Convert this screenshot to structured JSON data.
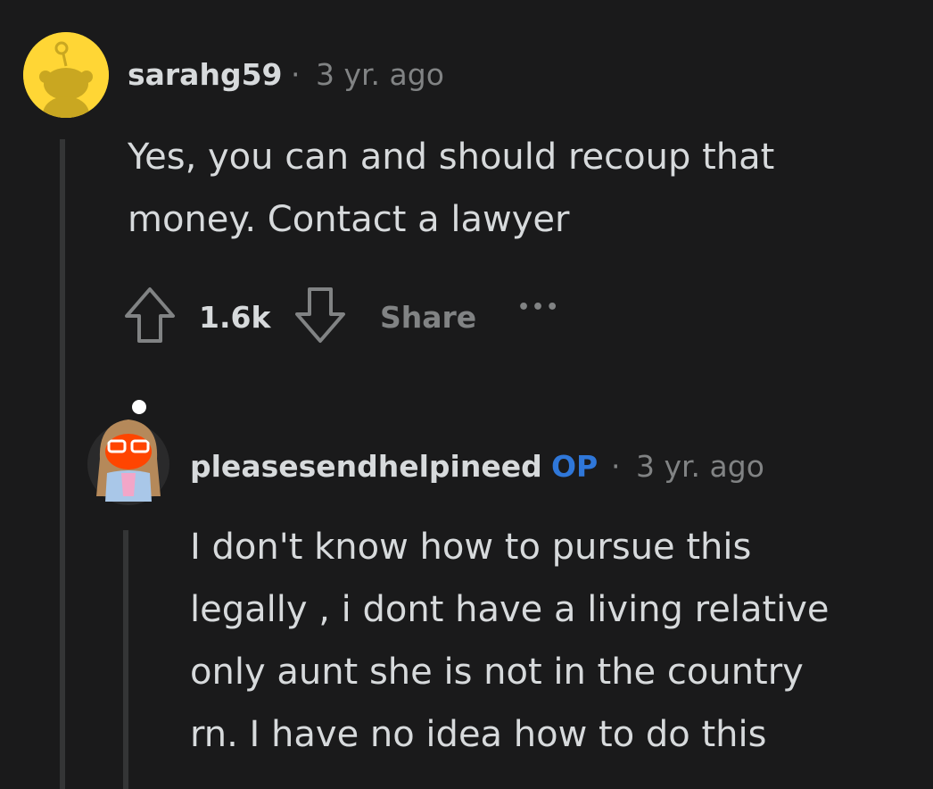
{
  "comment": {
    "username": "sarahg59",
    "separator": "·",
    "timestamp": "3 yr. ago",
    "body_line1": "Yes, you can and should recoup that",
    "body_line2": "money. Contact a lawyer",
    "vote_count": "1.6k",
    "share_label": "Share",
    "more_label": "•••",
    "avatar_color": "#ffd635"
  },
  "reply": {
    "username": "pleasesendhelpineed",
    "op_badge": "OP",
    "separator": "·",
    "timestamp": "3 yr. ago",
    "body_line1": "I don't know how to pursue this",
    "body_line2": "legally , i dont have a living relative",
    "body_line3": "only aunt she is not in the country",
    "body_line4": "rn. I have no idea how to do this"
  },
  "colors": {
    "background": "#1a1a1b",
    "text": "#d7dadc",
    "muted": "#818384",
    "op_blue": "#2f77d9",
    "thread_line": "#343536"
  }
}
